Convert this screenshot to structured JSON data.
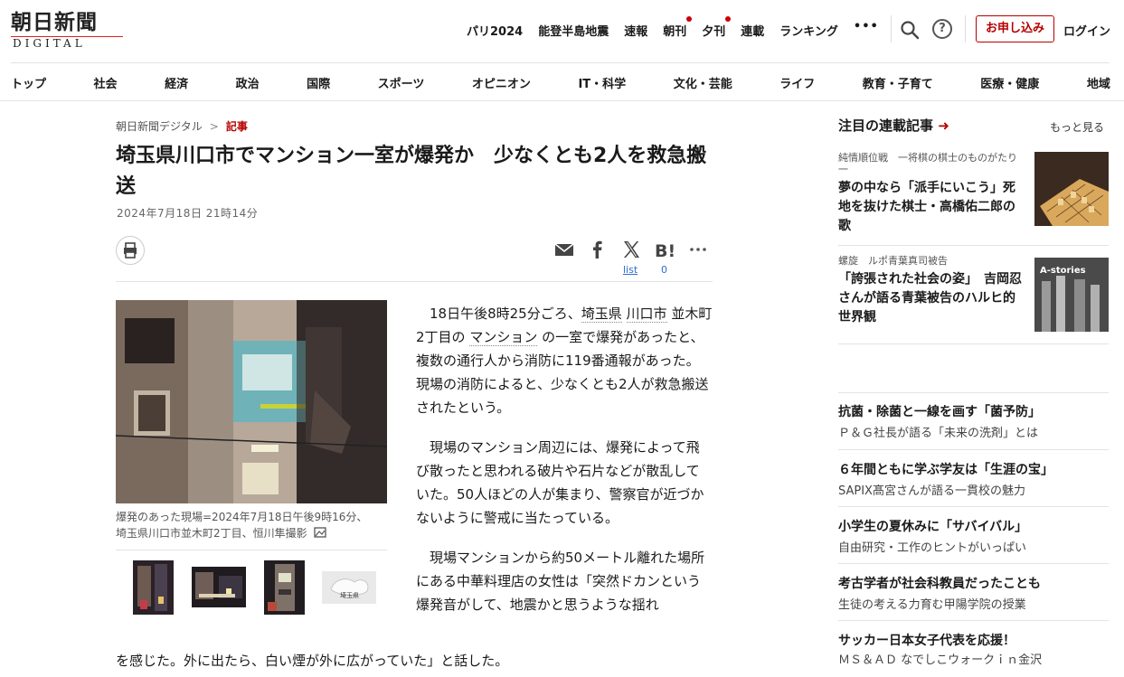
{
  "header": {
    "logo_jp": "朝日新聞",
    "logo_en": "DIGITAL",
    "top_nav": [
      "パリ2024",
      "能登半島地震",
      "速報",
      "朝刊",
      "夕刊",
      "連載",
      "ランキング"
    ],
    "more": "•••",
    "help": "?",
    "subscribe": "お申し込み",
    "login": "ログイン"
  },
  "main_nav": [
    "トップ",
    "社会",
    "経済",
    "政治",
    "国際",
    "スポーツ",
    "オピニオン",
    "IT・科学",
    "文化・芸能",
    "ライフ",
    "教育・子育て",
    "医療・健康",
    "地域"
  ],
  "breadcrumb": {
    "home": "朝日新聞デジタル",
    "sep": ">",
    "current": "記事"
  },
  "article": {
    "title": "埼玉県川口市でマンション一室が爆発か　少なくとも2人を救急搬送",
    "date": "2024年7月18日 21時14分",
    "share_list": "list",
    "share_count": "0",
    "caption": "爆発のあった現場=2024年7月18日午後9時16分、埼玉県川口市並木町2丁目、恒川隼撮影",
    "thumb_label": "埼玉県",
    "p1_a": "18日午後8時25分ごろ、",
    "kw1": "埼玉県",
    "kw2": "川口市",
    "p1_b": "並木町2丁目の",
    "kw3": "マンション",
    "p1_c": "の一室で爆発があったと、複数の通行人から消防に119番通報があった。現場の消防によると、少なくとも2人が救急搬送されたという。",
    "p2": "現場のマンション周辺には、爆発によって飛び散ったと思われる破片や石片などが散乱していた。50人ほどの人が集まり、警察官が近づかないように警戒に当たっている。",
    "p3_a": "現場マンションから約50メートル離れた場所にある中華料理店の女性は「突然ドカンという爆発音がして、地震かと思うような揺れ",
    "p3_b": "を感じた。外に出たら、白い煙が外に広がっていた」と話した。"
  },
  "sidebar": {
    "heading": "注目の連載記事",
    "arrow": "➜",
    "more": "もっと見る",
    "series": [
      {
        "tag": "純情順位戦　一将棋の棋士のものがたり一",
        "title": "夢の中なら「派手にいこう」死地を抜けた棋士・高橋佑二郎の歌"
      },
      {
        "tag": "螺旋　ルポ青葉真司被告",
        "title": "「誇張された社会の姿」　吉岡忍さんが語る青葉被告のハルヒ的世界観",
        "img_label": "A-stories"
      }
    ],
    "ads": [
      {
        "title": "抗菌・除菌と一線を画す「菌予防」",
        "sub": "Ｐ＆Ｇ社長が語る「未来の洗剤」とは"
      },
      {
        "title": "６年間ともに学ぶ学友は「生涯の宝」",
        "sub": "SAPIX髙宮さんが語る一貫校の魅力"
      },
      {
        "title": "小学生の夏休みに「サバイバル」",
        "sub": "自由研究・工作のヒントがいっぱい"
      },
      {
        "title": "考古学者が社会科教員だったことも",
        "sub": "生徒の考える力育む甲陽学院の授業"
      },
      {
        "title": "サッカー日本女子代表を応援！",
        "sub": "ＭＳ＆ＡＤ なでしこウォークｉｎ金沢"
      }
    ]
  }
}
